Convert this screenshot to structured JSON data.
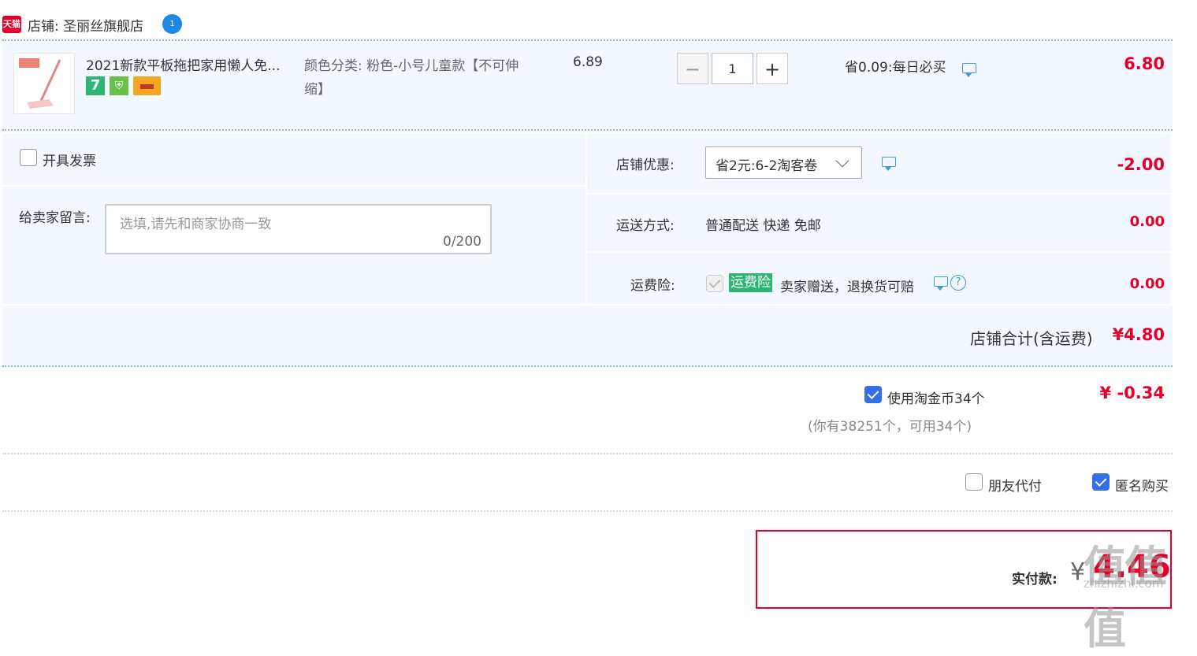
{
  "shop": {
    "logo_text": "天猫",
    "name": "店铺: 圣丽丝旗舰店",
    "im_badge": "1"
  },
  "item": {
    "title": "2021新款平板拖把家用懒人免...",
    "badges": [
      "7",
      "shield-icon",
      "card-icon"
    ],
    "sku": "颜色分类: 粉色-小号儿童款【不可伸缩】",
    "unit_price": "6.89",
    "quantity": "1",
    "qty_minus": "−",
    "qty_plus": "+",
    "discount_tip": "省0.09:每日必买",
    "row_total": "6.80"
  },
  "invoice": {
    "label": "开具发票",
    "checked": false
  },
  "message": {
    "label": "给卖家留言:",
    "placeholder": "选填,请先和商家协商一致",
    "counter": "0/200"
  },
  "shop_coupon": {
    "label": "店铺优惠:",
    "selected": "省2元:6-2淘客卷",
    "amount": "-2.00"
  },
  "shipping": {
    "label": "运送方式:",
    "method": "普通配送 快递 免邮",
    "amount": "0.00"
  },
  "insurance": {
    "label": "运费险:",
    "tag": "运费险",
    "desc": "卖家赠送，退换货可赔",
    "amount": "0.00",
    "help": "?"
  },
  "shop_total": {
    "label": "店铺合计(含运费)",
    "value": "¥4.80"
  },
  "coins": {
    "label": "使用淘金币34个",
    "checked": true,
    "amount": "¥ -0.34",
    "note": "(你有38251个，可用34个)"
  },
  "options": {
    "friend_pay": "朋友代付",
    "friend_pay_checked": false,
    "anonymous": "匿名购买",
    "anonymous_checked": true
  },
  "payment": {
    "label": "实付款:",
    "currency": "¥",
    "value": "4.46"
  },
  "watermark": {
    "text": "值值值",
    "url": "zhizhizhi.com"
  },
  "colors": {
    "accent_red": "#e4002b",
    "panel_bg": "#f3f8ff",
    "check_blue": "#3370e8",
    "tag_green": "#2bb673"
  }
}
